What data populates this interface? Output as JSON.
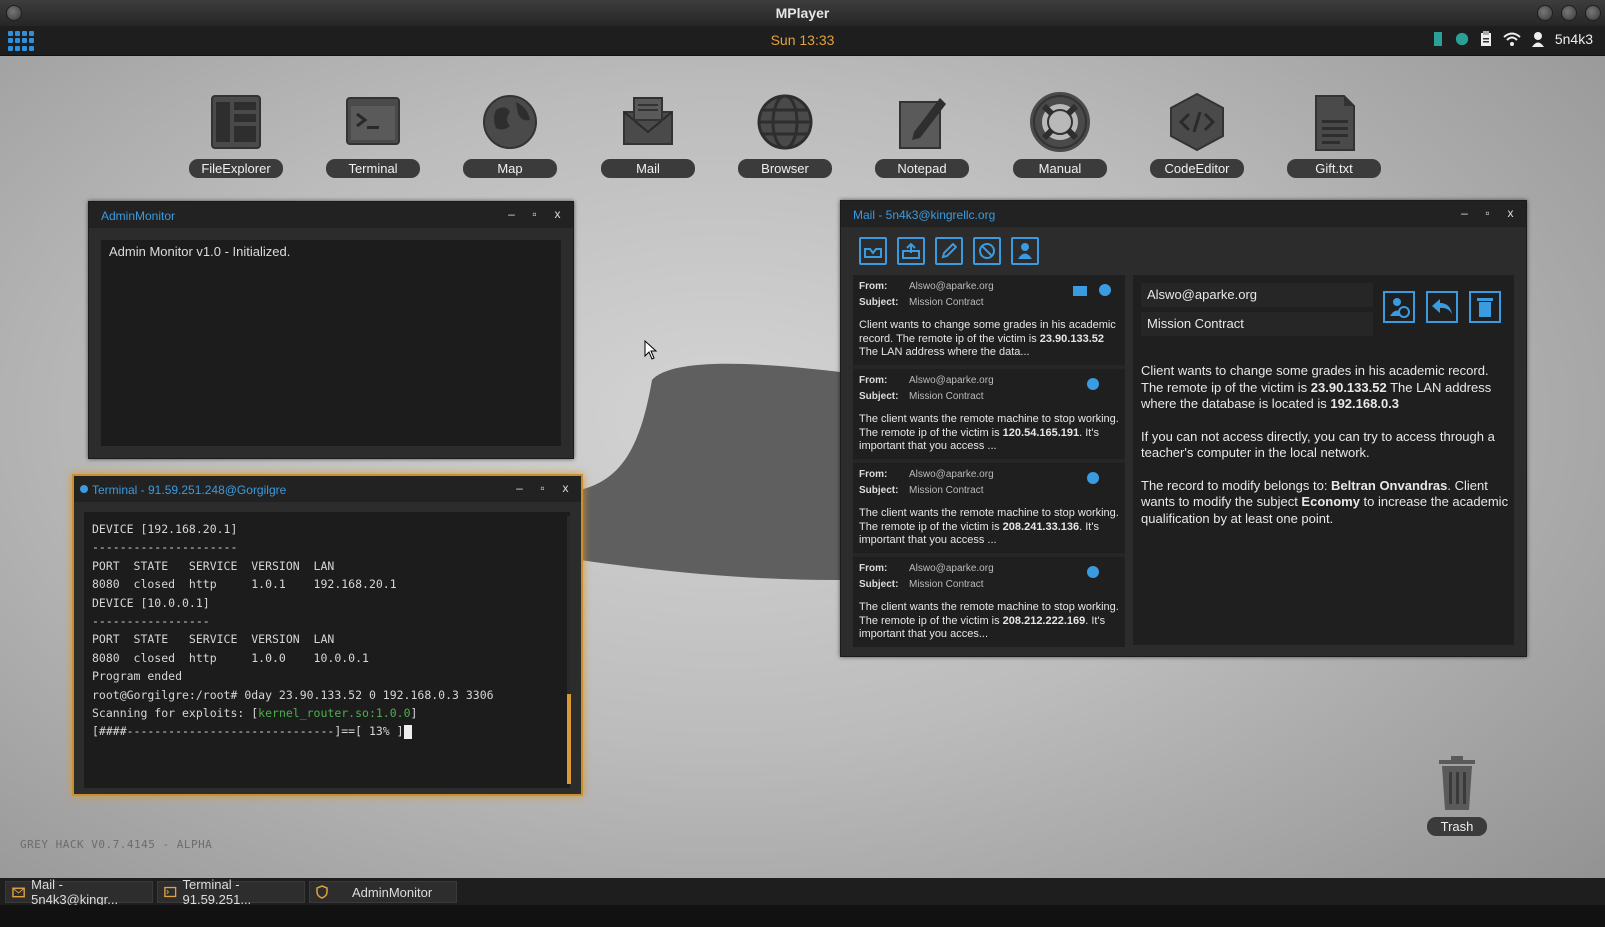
{
  "os": {
    "title": "MPlayer",
    "clock": "Sun 13:33",
    "user": "5n4k3",
    "version": "GREY HACK V0.7.4145 - ALPHA"
  },
  "desktop": {
    "icons": [
      {
        "label": "FileExplorer",
        "icon": "file-explorer-icon"
      },
      {
        "label": "Terminal",
        "icon": "terminal-icon"
      },
      {
        "label": "Map",
        "icon": "globe-icon"
      },
      {
        "label": "Mail",
        "icon": "envelope-icon"
      },
      {
        "label": "Browser",
        "icon": "browser-globe-icon"
      },
      {
        "label": "Notepad",
        "icon": "notepad-icon"
      },
      {
        "label": "Manual",
        "icon": "lifebuoy-icon"
      },
      {
        "label": "CodeEditor",
        "icon": "code-icon"
      },
      {
        "label": "Gift.txt",
        "icon": "text-file-icon"
      }
    ],
    "trash_label": "Trash"
  },
  "admin_monitor": {
    "title": "AdminMonitor",
    "text": "Admin Monitor v1.0 - Initialized."
  },
  "terminal": {
    "title": "Terminal - 91.59.251.248@Gorgilgre",
    "lines": [
      "DEVICE [192.168.20.1]",
      "---------------------",
      "PORT  STATE   SERVICE  VERSION  LAN",
      "8080  closed  http     1.0.1    192.168.20.1",
      "",
      "DEVICE [10.0.0.1]",
      "-----------------",
      "PORT  STATE   SERVICE  VERSION  LAN",
      "8080  closed  http     1.0.0    10.0.0.1",
      "",
      "Program ended",
      "root@Gorgilgre:/root# 0day 23.90.133.52 0 192.168.0.3 3306"
    ],
    "scan_prefix": "Scanning for exploits: [",
    "scan_lib": "kernel_router.so:1.0.0",
    "scan_suffix": "]",
    "progress_line": "[####------------------------------]==[ 13% ]",
    "progress": 0.13
  },
  "mail": {
    "title": "Mail - 5n4k3@kingrellc.org",
    "toolbar": [
      "inbox-icon",
      "outbox-icon",
      "compose-icon",
      "block-icon",
      "contacts-icon"
    ],
    "from_key": "From:",
    "subject_key": "Subject:",
    "list": [
      {
        "from": "Alswo@aparke.org",
        "subject": "Mission Contract",
        "preview_a": "Client wants to change some grades in his academic record. The remote ip of the victim is ",
        "preview_ip": "23.90.133.52",
        "preview_b": " The LAN address where the data..."
      },
      {
        "from": "Alswo@aparke.org",
        "subject": "Mission Contract",
        "preview_a": "The client wants the remote machine to stop working. The remote ip of the victim is ",
        "preview_ip": "120.54.165.191",
        "preview_b": ". It's important that you access ..."
      },
      {
        "from": "Alswo@aparke.org",
        "subject": "Mission Contract",
        "preview_a": "The client wants the remote machine to stop working. The remote ip of the victim is ",
        "preview_ip": "208.241.33.136",
        "preview_b": ". It's important that you access ..."
      },
      {
        "from": "Alswo@aparke.org",
        "subject": "Mission Contract",
        "preview_a": "The client wants the remote machine to stop working. The remote ip of the victim is ",
        "preview_ip": "208.212.222.169",
        "preview_b": ". It's important that you acces..."
      }
    ],
    "reader": {
      "from": "Alswo@aparke.org",
      "subject": "Mission Contract",
      "p1_a": "Client wants to change some grades in his academic record. The remote ip of the victim is ",
      "p1_ip": "23.90.133.52",
      "p1_b": " The LAN address where the database is located is ",
      "p1_lan": "192.168.0.3",
      "p2": "If you can not access directly, you can try to access through a teacher's computer in the local network.",
      "p3_a": "The record to modify belongs to: ",
      "p3_name": "Beltran Onvandras",
      "p3_b": ". Client wants to modify the subject ",
      "p3_subject": "Economy",
      "p3_c": " to increase the academic qualification by at least one point."
    }
  },
  "taskbar": [
    {
      "label": "Mail - 5n4k3@kingr...",
      "icon": "mail-icon"
    },
    {
      "label": "Terminal - 91.59.251...",
      "icon": "terminal-icon"
    },
    {
      "label": "AdminMonitor",
      "icon": "shield-icon"
    }
  ],
  "colors": {
    "accent": "#3a9be0",
    "clock": "#e2a23a",
    "terminal_border": "#c8902e",
    "green": "#4bb04b"
  }
}
